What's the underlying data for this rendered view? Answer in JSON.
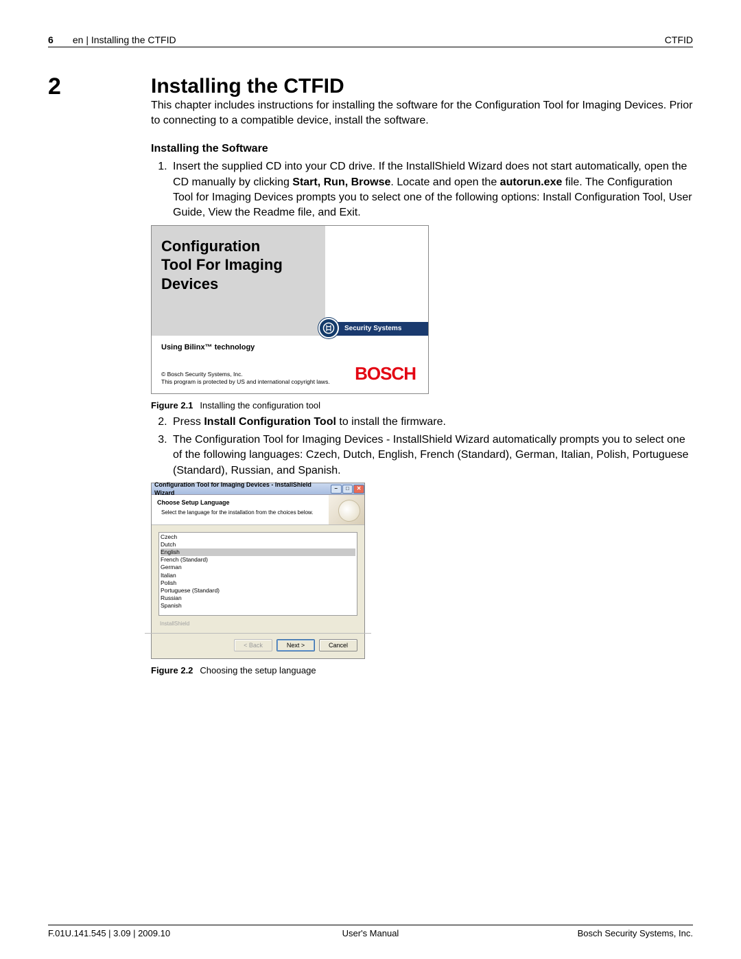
{
  "header": {
    "page_number": "6",
    "breadcrumb": "en | Installing the CTFID",
    "right": "CTFID"
  },
  "section": {
    "number": "2",
    "title": "Installing the CTFID",
    "intro": "This chapter includes instructions for installing the software for the Configuration Tool for Imaging Devices. Prior to connecting to a compatible device, install the software."
  },
  "subhead": "Installing the Software",
  "step1": {
    "pre": "Insert the supplied CD into your CD drive. If the InstallShield Wizard does not start automatically, open the CD manually by clicking ",
    "bold1": "Start, Run, Browse",
    "mid": ". Locate and open the ",
    "bold2": "autorun.exe",
    "post": " file. The Configuration Tool for Imaging Devices prompts you to select one of the following options: Install Configuration Tool, User Guide, View the Readme file, and Exit."
  },
  "fig1": {
    "label": "Figure 2.1",
    "caption": "Installing the configuration tool",
    "title_l1": "Configuration",
    "title_l2": "Tool For Imaging",
    "title_l3": "Devices",
    "security": "Security Systems",
    "mid": "Using Bilinx™ technology",
    "copy1": "© Bosch Security Systems, Inc.",
    "copy2": "This program is protected by US and international copyright laws.",
    "logo": "BOSCH"
  },
  "step2": {
    "pre": "Press ",
    "bold": "Install Configuration Tool",
    "post": " to install the firmware."
  },
  "step3": "The Configuration Tool for Imaging Devices - InstallShield Wizard automatically prompts you to select one of the following languages: Czech, Dutch, English, French (Standard), German, Italian, Polish, Portuguese (Standard), Russian, and Spanish.",
  "fig2": {
    "label": "Figure 2.2",
    "caption": "Choosing the setup language",
    "titlebar": "Configuration Tool for Imaging Devices - InstallShield Wizard",
    "head1": "Choose Setup Language",
    "head2": "Select the language for the installation from the choices below.",
    "languages": [
      "Czech",
      "Dutch",
      "English",
      "French (Standard)",
      "German",
      "Italian",
      "Polish",
      "Portuguese (Standard)",
      "Russian",
      "Spanish"
    ],
    "selected": "English",
    "brand": "InstallShield",
    "btn_back": "< Back",
    "btn_next": "Next >",
    "btn_cancel": "Cancel"
  },
  "footer": {
    "left": "F.01U.141.545 | 3.09 | 2009.10",
    "mid": "User's Manual",
    "right": "Bosch Security Systems, Inc."
  }
}
